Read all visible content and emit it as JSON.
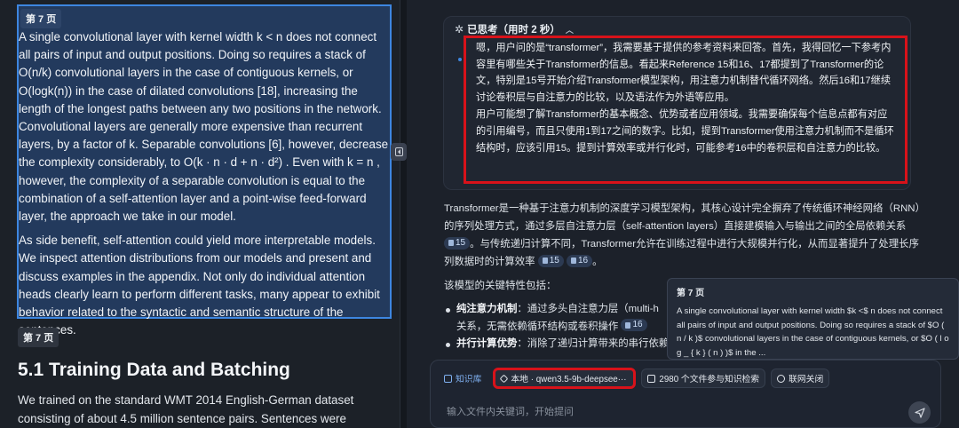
{
  "document": {
    "page_tag_1": "第 7 页",
    "selected_paragraph_1": "A single convolutional layer with kernel width k < n does not connect all pairs of input and output positions. Doing so requires a stack of O(n/k) convolutional layers in the case of contiguous kernels, or O(logk(n)) in the case of dilated convolutions [18], increasing the length of the longest paths between any two positions in the network. Convolutional layers are generally more expensive than recurrent layers, by a factor of k. Separable convolutions [6], however, decrease the complexity considerably, to O(k · n · d + n · d²) . Even with k = n , however, the complexity of a separable convolution is equal to the combination of a self-attention layer and a point-wise feed-forward layer, the approach we take in our model.",
    "selected_paragraph_2": "As side benefit, self-attention could yield more interpretable models. We inspect attention distributions from our models and present and discuss examples in the appendix. Not only do individual attention heads clearly learn to perform different tasks, many appear to exhibit behavior related to the syntactic and semantic structure of the sentences.",
    "page_tag_2": "第 7 页",
    "section_title": "5.1 Training Data and Batching",
    "body_tail": "We trained on the standard WMT 2014 English-German dataset consisting of about 4.5 million sentence pairs. Sentences were encoded"
  },
  "chat": {
    "thinking_header": "已思考（用时 2 秒）",
    "thinking_p1": "嗯，用户问的是“transformer”，我需要基于提供的参考资料来回答。首先，我得回忆一下参考内容里有哪些关于Transformer的信息。看起来Reference 15和16、17都提到了Transformer的论文，特别是15号开始介绍Transformer模型架构，用注意力机制替代循环网络。然后16和17继续讨论卷积层与自注意力的比较，以及语法作为外语等应用。",
    "thinking_p2": "用户可能想了解Transformer的基本概念、优势或者应用领域。我需要确保每个信息点都有对应的引用编号，而且只使用1到17之间的数字。比如，提到Transformer使用注意力机制而不是循环结构时，应该引用15。提到计算效率或并行化时，可能参考16中的卷积层和自注意力的比较。",
    "answer_a": "Transformer是一种基于注意力机制的深度学习模型架构，其核心设计完全摒弃了传统循环神经网络（RNN）的序列处理方式，通过多层自注意力层（self-attention layers）直接建模输入与输出之间的全局依赖关系",
    "answer_b": "。与传统递归计算不同，Transformer允许在训练过程中进行大规模并行化，从而显著提升了处理长序列数据时的计算效率",
    "answer_c": "。",
    "ref_15": "15",
    "ref_16": "16",
    "features_label": "该模型的关键特性包括：",
    "feature_1_title": "纯注意力机制",
    "feature_1_text": "：通过多头自注意力层（multi-h",
    "feature_1_text2": "关系，无需依赖循环结构或卷积操作",
    "feature_2_title": "并行计算优势",
    "feature_2_text": "：消除了递归计算带来的串行依赖"
  },
  "tooltip": {
    "title": "第 7 页",
    "body": "A single convolutional layer with kernel width $k <$ n does not connect all pairs of input and output positions. Doing so requires a stack of $O ( n / k )$ convolutional layers in the case of contiguous kernels, or $O ( l o g _ { k } ( n ) )$ in the ..."
  },
  "input": {
    "kb_label": "知识库",
    "model_label": "本地 · qwen3.5-9b-deepsee···",
    "files_label": "2980 个文件参与知识检索",
    "web_label": "联网关闭",
    "placeholder": "输入文件内关键词，开始提问"
  },
  "colors": {
    "selection_border": "#3d86e0",
    "highlight_box": "#d8121a",
    "accent": "#7fb0f0"
  }
}
